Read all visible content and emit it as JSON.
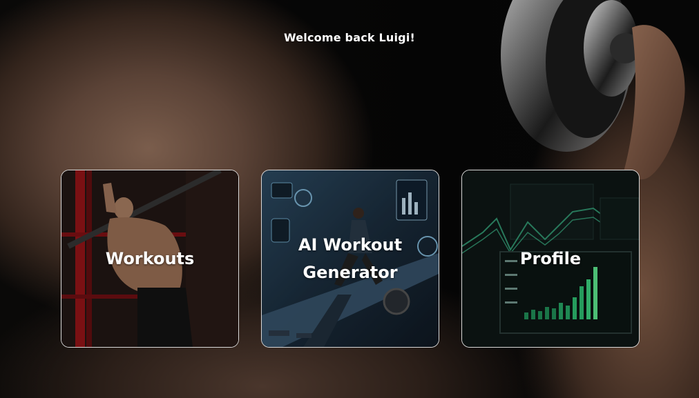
{
  "header": {
    "greeting": "Welcome back Luigi!"
  },
  "cards": [
    {
      "label": "Workouts",
      "icon": "pullup-photo"
    },
    {
      "label": "AI Workout Generator",
      "icon": "ai-treadmill-illustration"
    },
    {
      "label": "Profile",
      "icon": "dashboard-charts-photo"
    }
  ],
  "colors": {
    "text": "#ffffff",
    "card_border": "#d9d9d9",
    "background": "#050505",
    "chart_green": "#2ecc71"
  }
}
